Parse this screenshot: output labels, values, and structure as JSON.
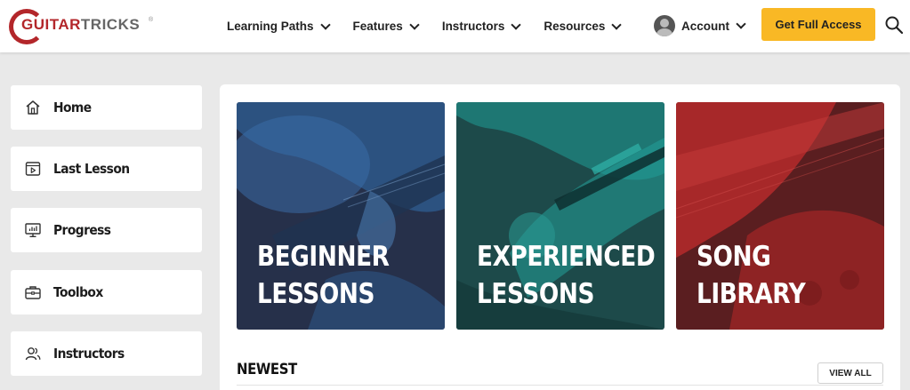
{
  "brand": {
    "logo_main": "GUITAR",
    "logo_accent": "TRICKS",
    "logo_mark": "®",
    "colors": {
      "red": "#b3262a",
      "cta": "#f9b825"
    }
  },
  "nav": {
    "items": [
      {
        "label": "Learning Paths"
      },
      {
        "label": "Features"
      },
      {
        "label": "Instructors"
      },
      {
        "label": "Resources"
      }
    ]
  },
  "account": {
    "label": "Account"
  },
  "cta": {
    "label": "Get Full Access"
  },
  "sidebar": {
    "items": [
      {
        "label": "Home",
        "icon": "home-icon"
      },
      {
        "label": "Last Lesson",
        "icon": "play-video-icon"
      },
      {
        "label": "Progress",
        "icon": "monitor-chart-icon"
      },
      {
        "label": "Toolbox",
        "icon": "toolbox-icon"
      },
      {
        "label": "Instructors",
        "icon": "users-icon"
      }
    ]
  },
  "cards": [
    {
      "line1": "BEGINNER",
      "line2": "LESSONS",
      "color": "#2f5d93"
    },
    {
      "line1": "EXPERIENCED",
      "line2": "LESSONS",
      "color": "#1f8a85"
    },
    {
      "line1": "SONG",
      "line2": "LIBRARY",
      "color": "#b52a2b"
    }
  ],
  "section": {
    "title": "NEWEST",
    "view_all": "VIEW ALL"
  }
}
